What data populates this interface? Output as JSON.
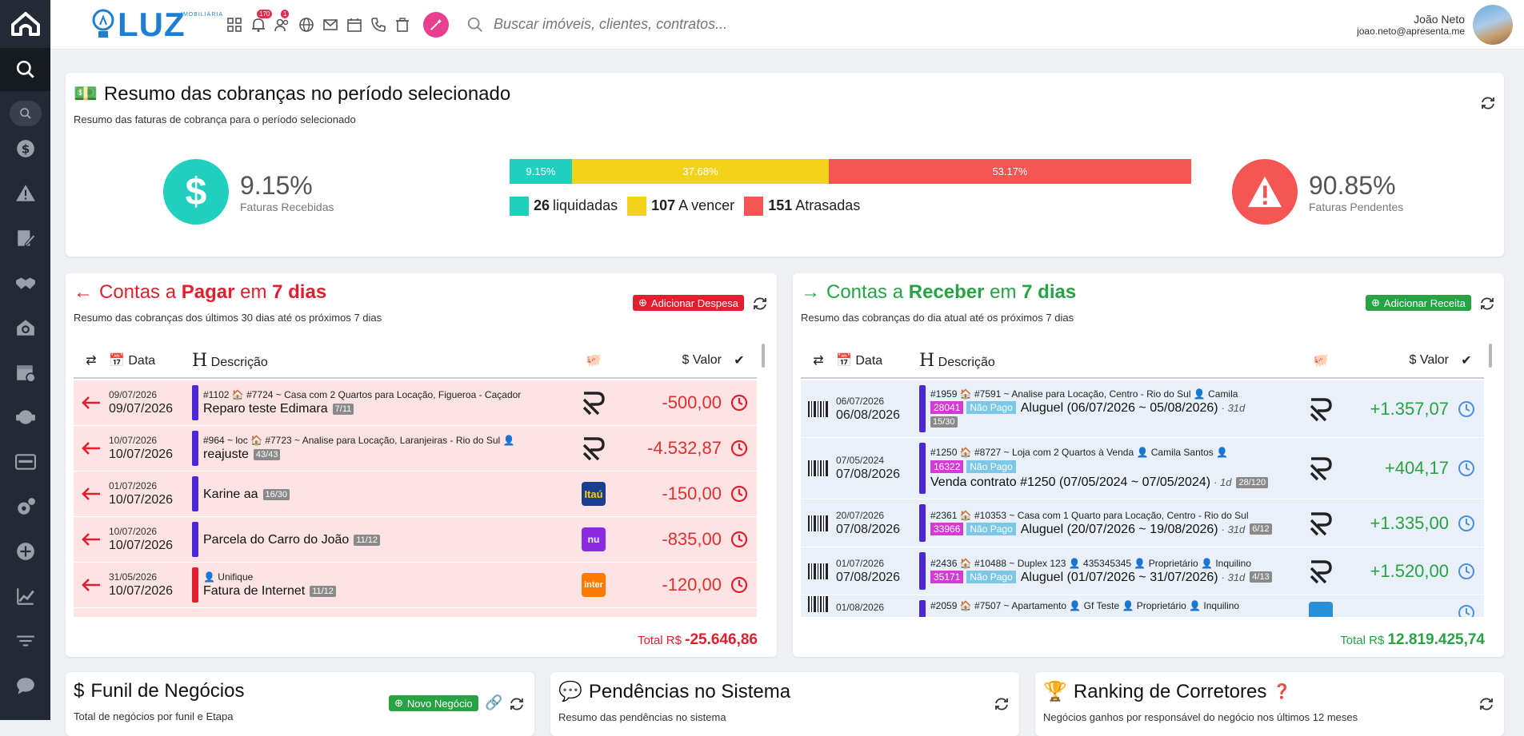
{
  "header": {
    "brand_small": "IMOBILIÁRIA",
    "brand": "LUZ",
    "badges": {
      "notifications": "170",
      "users": "1"
    },
    "search_placeholder": "Buscar imóveis, clientes, contratos...",
    "user_name": "João Neto",
    "user_email": "joao.neto@apresenta.me"
  },
  "summary": {
    "title": "Resumo das cobranças no período selecionado",
    "subtitle": "Resumo das faturas de cobrança para o período selecionado",
    "received_pct": "9.15%",
    "received_label": "Faturas Recebidas",
    "pending_pct": "90.85%",
    "pending_label": "Faturas Pendentes",
    "bar": [
      {
        "label": "9.15%",
        "value": 9.15,
        "color": "#21cfbf"
      },
      {
        "label": "37.68%",
        "value": 37.68,
        "color": "#f3d21a"
      },
      {
        "label": "53.17%",
        "value": 53.17,
        "color": "#f45653"
      }
    ],
    "legend": [
      {
        "count": "26",
        "label": "liquidadas",
        "color": "#21cfbf"
      },
      {
        "count": "107",
        "label": "A vencer",
        "color": "#f3d21a"
      },
      {
        "count": "151",
        "label": "Atrasadas",
        "color": "#f45653"
      }
    ]
  },
  "pay": {
    "title_a": "Contas a",
    "title_b": "Pagar",
    "title_c": "em",
    "title_d": "7 dias",
    "subtitle": "Resumo das cobranças dos últimos 30 dias até os próximos 7 dias",
    "add_label": "Adicionar Despesa",
    "columns": {
      "date": "Data",
      "desc": "Descrição",
      "value": "Valor"
    },
    "rows": [
      {
        "d1": "09/07/2026",
        "d2": "09/07/2026",
        "meta": "#1102 🏠 #7724 ~ Casa com 2 Quartos para Locação, Figueroa - Caçador",
        "desc": "Reparo teste Edimara",
        "chip": "7/11",
        "bank": "R",
        "value": "-500,00",
        "bar": "#4b27d6"
      },
      {
        "d1": "10/07/2026",
        "d2": "10/07/2026",
        "meta": "#964 ~ loc 🏠 #7723 ~ Analise para Locação, Laranjeiras - Rio do Sul 👤",
        "desc": "reajuste",
        "chip": "43/43",
        "bank": "R",
        "value": "-4.532,87",
        "bar": "#4b27d6"
      },
      {
        "d1": "01/07/2026",
        "d2": "10/07/2026",
        "meta": "",
        "desc": "Karine aa",
        "chip": "16/30",
        "bank": "Itaú",
        "value": "-150,00",
        "bar": "#4b27d6"
      },
      {
        "d1": "10/07/2026",
        "d2": "10/07/2026",
        "meta": "",
        "desc": "Parcela do Carro do João",
        "chip": "11/12",
        "bank": "nu",
        "value": "-835,00",
        "bar": "#4b27d6"
      },
      {
        "d1": "31/05/2026",
        "d2": "10/07/2026",
        "meta": "👤 Unifique",
        "desc": "Fatura de Internet",
        "chip": "11/12",
        "bank": "inter",
        "value": "-120,00",
        "bar": "#e0202e"
      }
    ],
    "total_label": "Total R$",
    "total_value": "-25.646,86"
  },
  "rec": {
    "title_a": "Contas a",
    "title_b": "Receber",
    "title_c": "em",
    "title_d": "7 dias",
    "subtitle": "Resumo das cobranças do dia atual até os próximos 7 dias",
    "add_label": "Adicionar Receita",
    "columns": {
      "date": "Data",
      "desc": "Descrição",
      "value": "Valor"
    },
    "rows": [
      {
        "d1": "06/07/2026",
        "d2": "06/08/2026",
        "meta": "#1959 🏠 #7591 ~ Analise para Locação, Centro - Rio do Sul 👤 Camila",
        "code": "28041",
        "status": "Não Pago",
        "desc": "Aluguel (06/07/2026 ~ 05/08/2026)",
        "days": "· 31d",
        "chip": "15/30",
        "value": "+1.357,07"
      },
      {
        "d1": "07/05/2024",
        "d2": "07/08/2026",
        "meta": "#1250 🏠 #8727 ~ Loja com 2 Quartos à Venda 👤 Camila Santos 👤",
        "code": "16322",
        "status": "Não Pago",
        "desc": "Venda contrato #1250 (07/05/2024 ~ 07/05/2024)",
        "days": "· 1d",
        "chip": "28/120",
        "value": "+404,17"
      },
      {
        "d1": "20/07/2026",
        "d2": "07/08/2026",
        "meta": "#2361 🏠 #10353 ~ Casa com 1 Quarto para Locação, Centro - Rio do Sul",
        "code": "33966",
        "status": "Não Pago",
        "desc": "Aluguel (20/07/2026 ~ 19/08/2026)",
        "days": "· 31d",
        "chip": "6/12",
        "value": "+1.335,00"
      },
      {
        "d1": "01/07/2026",
        "d2": "07/08/2026",
        "meta": "#2436 🏠 #10488 ~ Duplex 123 👤 435345345 👤 Proprietário 👤 Inquilino",
        "code": "35171",
        "status": "Não Pago",
        "desc": "Aluguel (01/07/2026 ~ 31/07/2026)",
        "days": "· 31d",
        "chip": "4/13",
        "value": "+1.520,00"
      },
      {
        "d1": "01/08/2026",
        "d2": "",
        "meta": "#2059 🏠 #7507 ~ Apartamento 👤 Gf Teste 👤 Proprietário 👤 Inquilino",
        "code": "",
        "status": "",
        "desc": "",
        "days": "",
        "chip": "",
        "value": ""
      }
    ],
    "total_label": "Total R$",
    "total_value": "12.819.425,74"
  },
  "bottom": {
    "funnel_title": "Funil de Negócios",
    "funnel_sub": "Total de negócios por funil e Etapa",
    "new_deal": "Novo Negócio",
    "pend_title": "Pendências no Sistema",
    "pend_sub": "Resumo das pendências no sistema",
    "rank_title": "Ranking de Corretores",
    "rank_sub": "Negócios ganhos por responsável do negócio nos últimos 12 meses"
  }
}
